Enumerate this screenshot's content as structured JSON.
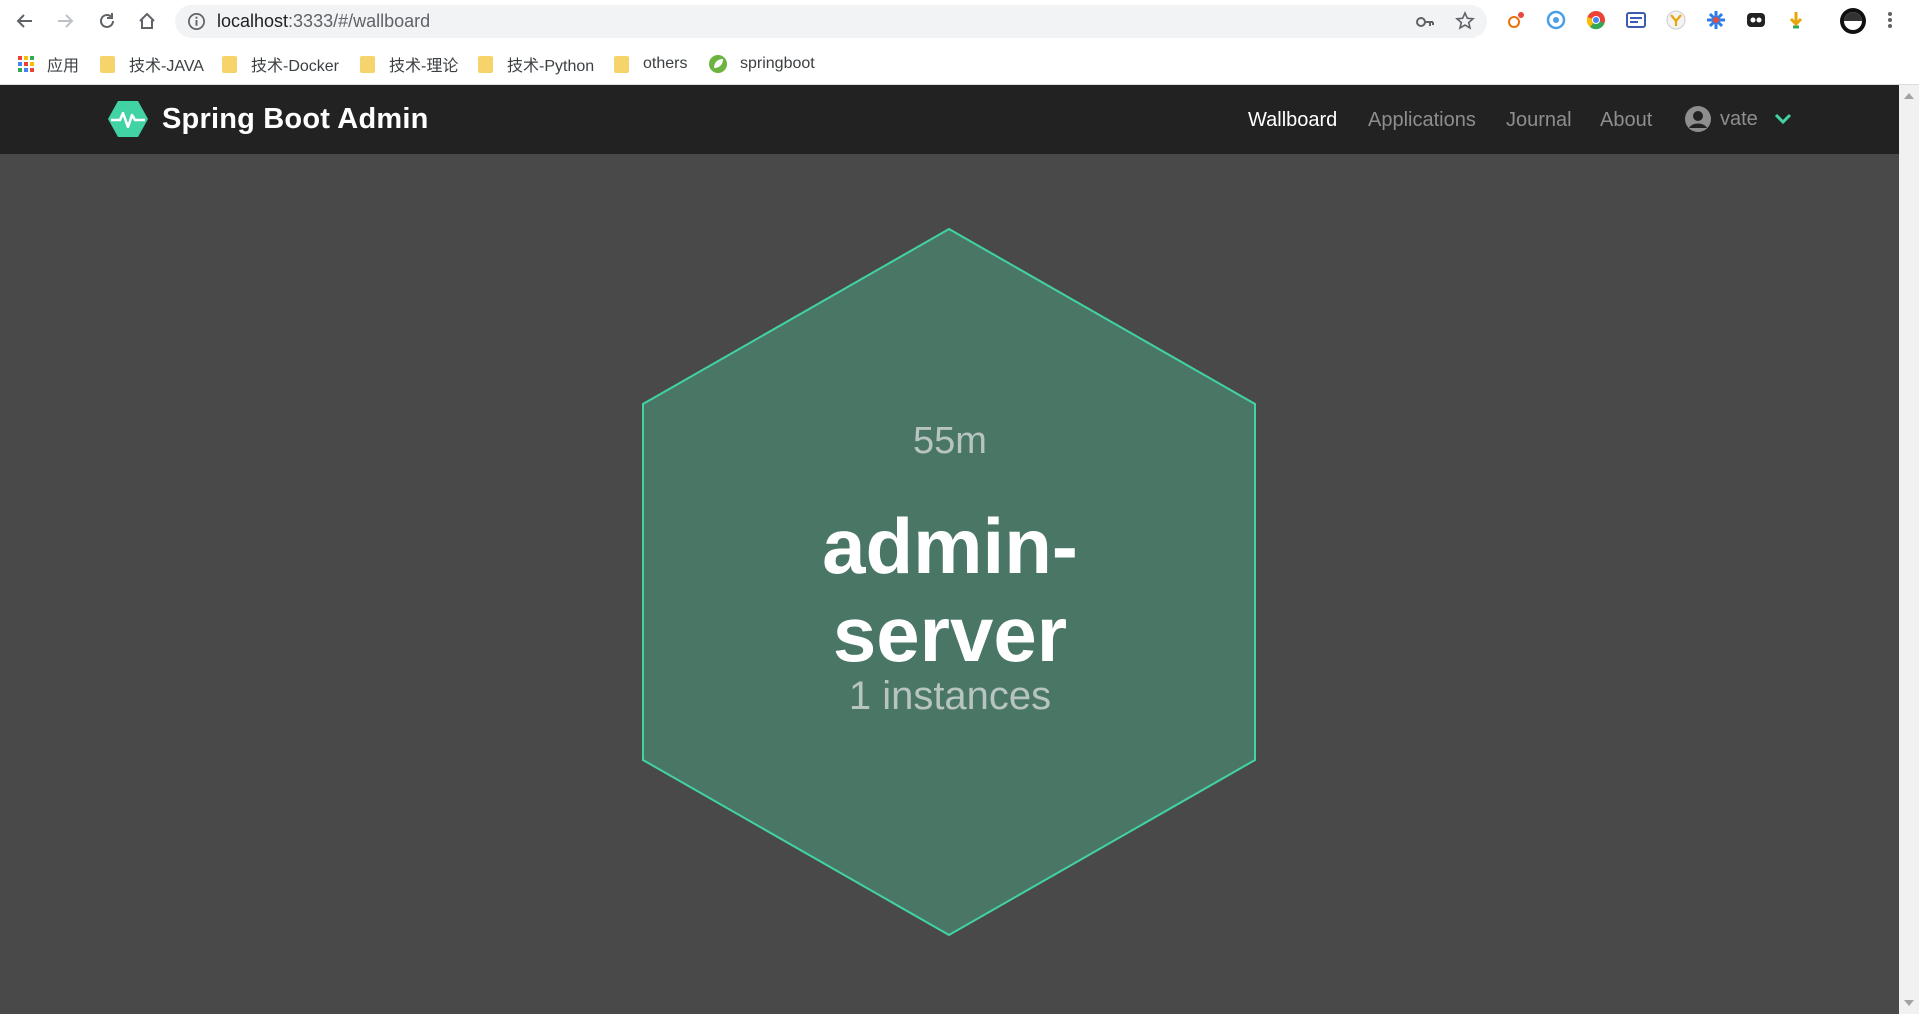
{
  "browser": {
    "url_host": "localhost",
    "url_rest": ":3333/#/wallboard",
    "bookmarks": [
      "应用",
      "技术-JAVA",
      "技术-Docker",
      "技术-理论",
      "技术-Python",
      "others",
      "springboot"
    ]
  },
  "navbar": {
    "brand": "Spring Boot Admin",
    "links": [
      "Wallboard",
      "Applications",
      "Journal",
      "About"
    ],
    "active": "Wallboard",
    "user": "vate"
  },
  "wallboard": {
    "application": {
      "uptime": "55m",
      "name_line1": "admin-",
      "name_line2": "server",
      "instances": "1 instances",
      "status_color": "#42d3a5",
      "fill_color": "#4a7666"
    }
  },
  "colors": {
    "navbar_bg": "#222222",
    "board_bg": "#494949",
    "accent": "#42d3a5"
  }
}
